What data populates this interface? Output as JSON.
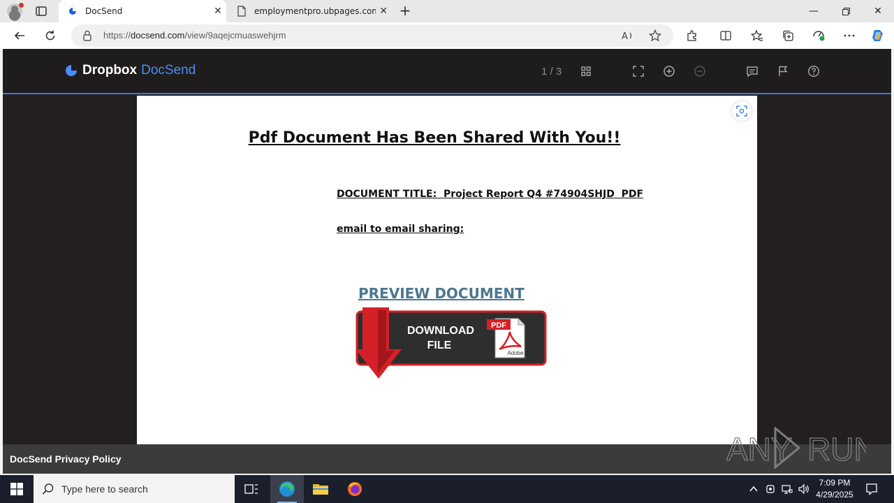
{
  "browser": {
    "tabs": [
      {
        "title": "DocSend",
        "active": true
      },
      {
        "title": "employmentpro.ubpages.com/b",
        "active": false
      }
    ],
    "url_prefix": "https://",
    "url_domain": "docsend.com",
    "url_path": "/view/9aqejcmuaswehjrm"
  },
  "viewer": {
    "logo_brand": "Dropbox",
    "logo_product": "DocSend",
    "page_indicator": "1 / 3",
    "accent_color": "#3a7bdc"
  },
  "document": {
    "heading": "Pdf Document Has Been Shared With You!!",
    "title_line": "DOCUMENT TITLE:  Project Report Q4 #74904SHJD  PDF",
    "sharing_line": "email to email sharing:",
    "preview_link": "PREVIEW DOCUMENT",
    "download_button": {
      "line1": "DOWNLOAD",
      "line2": "FILE",
      "badge": "PDF",
      "brand": "Adobe"
    }
  },
  "footer": {
    "privacy_link": "DocSend Privacy Policy"
  },
  "watermark": "ANY RUN",
  "taskbar": {
    "search_placeholder": "Type here to search",
    "time": "7:09 PM",
    "date": "4/29/2025"
  }
}
